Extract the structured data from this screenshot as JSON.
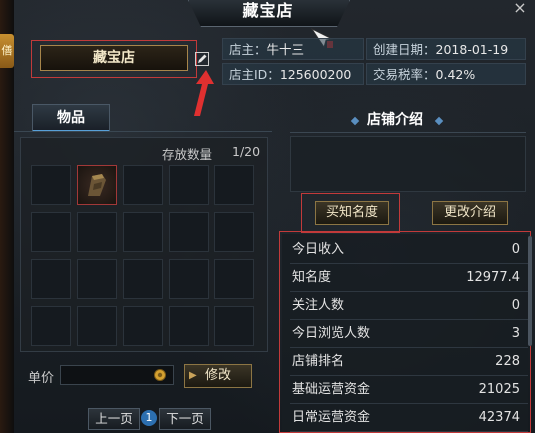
{
  "window": {
    "title": "藏宝店",
    "close_label": "×",
    "left_tag": "僐"
  },
  "shop": {
    "name": "藏宝店"
  },
  "info": {
    "owner_label": "店主：",
    "owner_value": "牛十三",
    "created_label": "创建日期：",
    "created_value": "2018-01-19",
    "owner_id_label": "店主ID：",
    "owner_id_value": "125600200",
    "tax_label": "交易税率：",
    "tax_value": "0.42%"
  },
  "tabs": [
    {
      "label": "物品"
    }
  ],
  "items_panel": {
    "store_count_label": "存放数量",
    "store_count_value": "1/20"
  },
  "price": {
    "label": "单价",
    "modify_label": "修改"
  },
  "pagination": {
    "prev_label": "上一页",
    "page": "1",
    "next_label": "下一页"
  },
  "intro": {
    "header": "店铺介绍",
    "buy_fame_label": "买知名度",
    "change_intro_label": "更改介绍"
  },
  "stats": [
    {
      "label": "今日收入",
      "value": "0"
    },
    {
      "label": "知名度",
      "value": "12977.4"
    },
    {
      "label": "关注人数",
      "value": "0"
    },
    {
      "label": "今日浏览人数",
      "value": "3"
    },
    {
      "label": "店铺排名",
      "value": "228"
    },
    {
      "label": "基础运营资金",
      "value": "21025"
    },
    {
      "label": "日常运营资金",
      "value": "42374"
    }
  ],
  "colors": {
    "highlight_red": "#c23a3a",
    "tab_accent": "#58a0d8",
    "gold_border": "#8c7544"
  }
}
